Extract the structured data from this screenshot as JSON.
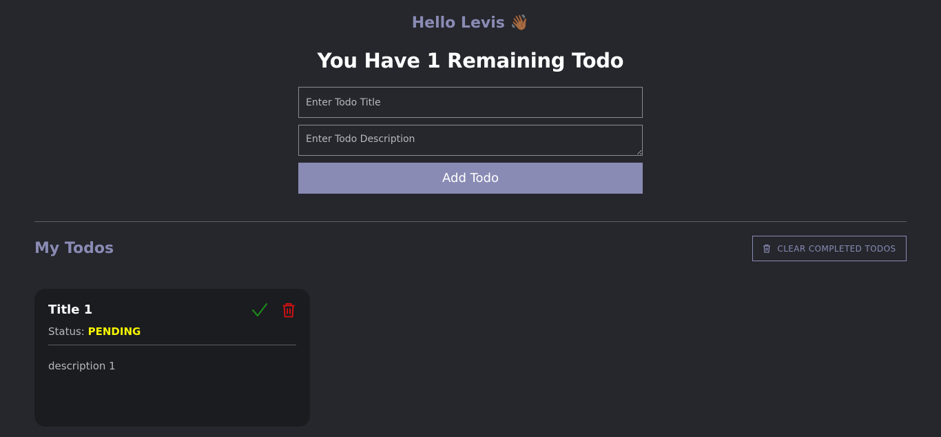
{
  "header": {
    "greeting": "Hello Levis",
    "wave_emoji": "👋🏾",
    "remaining_text": "You Have 1 Remaining Todo"
  },
  "form": {
    "title_placeholder": "Enter Todo Title",
    "title_value": "",
    "description_placeholder": "Enter Todo Description",
    "description_value": "",
    "add_button_label": "Add Todo"
  },
  "todos_section": {
    "title": "My Todos",
    "clear_button_label": "CLEAR COMPLETED TODOS",
    "clear_button_icon": "trash-icon"
  },
  "todos": [
    {
      "title": "Title 1",
      "status_label": "Status:",
      "status_value": "PENDING",
      "description": "description 1",
      "complete_icon": "check-icon",
      "delete_icon": "trash-icon"
    }
  ],
  "colors": {
    "background": "#25272d",
    "accent": "#8a8bb4",
    "card_background": "#1b1c20",
    "status_pending": "#f5f500",
    "complete": "#1a8a1a",
    "delete": "#e01010"
  }
}
